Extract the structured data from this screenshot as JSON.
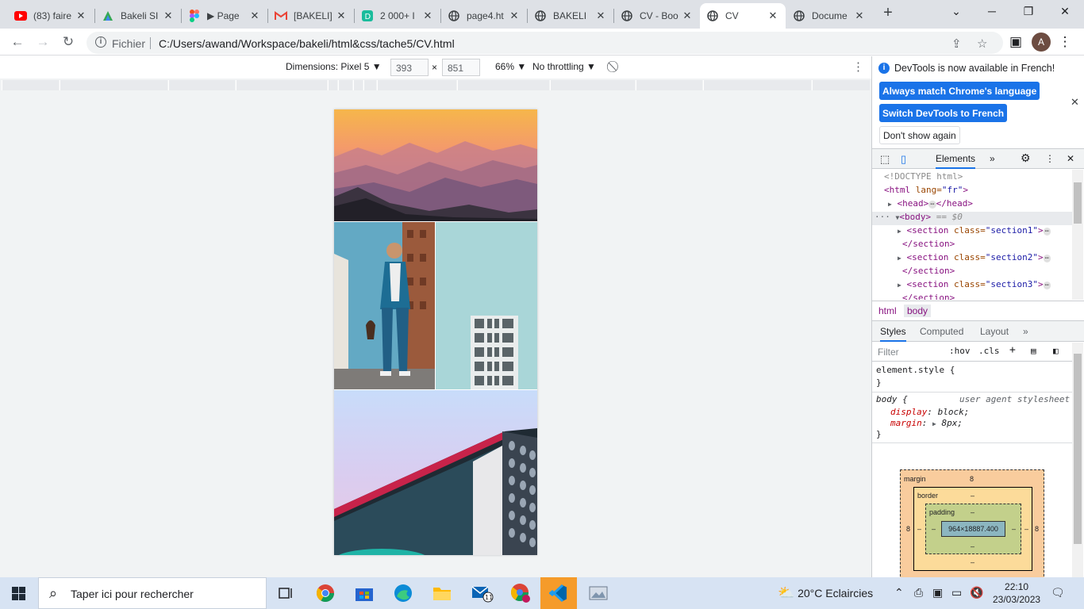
{
  "browser": {
    "tabs": [
      {
        "title": "(83) faire",
        "icon": "youtube-icon",
        "active": false
      },
      {
        "title": "Bakeli SI",
        "icon": "bakeli-icon",
        "active": false
      },
      {
        "title": "▶ Page",
        "icon": "figma-icon",
        "active": false
      },
      {
        "title": "[BAKELI]",
        "icon": "gmail-icon",
        "active": false
      },
      {
        "title": "2 000+ I",
        "icon": "d-icon",
        "active": false
      },
      {
        "title": "page4.ht",
        "icon": "globe-icon",
        "active": false
      },
      {
        "title": "BAKELI",
        "icon": "globe-icon",
        "active": false
      },
      {
        "title": "CV - Boo",
        "icon": "globe-icon",
        "active": false
      },
      {
        "title": "CV",
        "icon": "globe-icon",
        "active": true
      },
      {
        "title": "Docume",
        "icon": "globe-icon",
        "active": false
      }
    ],
    "new_tab": "+",
    "address": {
      "scheme_label": "Fichier",
      "url": "C:/Users/awand/Workspace/bakeli/html&css/tache5/CV.html"
    },
    "profile_initial": "A"
  },
  "device_toolbar": {
    "dimensions_label": "Dimensions: Pixel 5 ▼",
    "width": "393",
    "times": "×",
    "height": "851",
    "zoom": "66% ▼",
    "throttling": "No throttling ▼"
  },
  "devtools": {
    "notice": "DevTools is now available in French!",
    "btn_match": "Always match Chrome's language",
    "btn_switch": "Switch DevTools to French",
    "btn_dont_show": "Don't show again",
    "panel_tab": "Elements",
    "dom": {
      "doctype": "<!DOCTYPE html>",
      "html_open_tag": "<html",
      "html_attr": " lang=",
      "html_attr_val": "\"fr\"",
      "html_close": ">",
      "head_open": "<head>",
      "head_close": "</head>",
      "body_open": "<body>",
      "body_eq": " == $0",
      "section_open": "<section",
      "section_attr": " class=",
      "section1_val": "\"section1\"",
      "section2_val": "\"section2\"",
      "section3_val": "\"section3\"",
      "gt": ">",
      "section_close": "</section>",
      "ellipsis": "⋯"
    },
    "breadcrumbs": [
      "html",
      "body"
    ],
    "sub_tabs": [
      "Styles",
      "Computed",
      "Layout"
    ],
    "filter_placeholder": "Filter",
    "filter_hov": ":hov",
    "filter_cls": ".cls",
    "styles": {
      "element_style": "element.style {",
      "close_brace": "}",
      "body_selector": "body {",
      "ua_source": "user agent stylesheet",
      "p1_name": "display",
      "p1_val": "block;",
      "p2_name": "margin",
      "p2_val": "8px;"
    },
    "box_model": {
      "margin_label": "margin",
      "margin_top": "8",
      "margin_left": "8",
      "margin_right": "8",
      "border_label": "border",
      "border_top": "–",
      "border_bottom": "–",
      "border_left": "–",
      "border_right": "–",
      "padding_label": "padding",
      "padding_top": "–",
      "padding_bottom": "–",
      "padding_left": "–",
      "padding_right": "–",
      "content": "964×18887.400"
    }
  },
  "taskbar": {
    "search_placeholder": "Taper ici pour rechercher",
    "weather": "20°C  Eclaircies",
    "time": "22:10",
    "date": "23/03/2023",
    "mail_badge": "11"
  },
  "colors": {
    "accent": "#1a73e8",
    "taskbar_bg": "#d7e3f3",
    "tab_strip": "#dee1e6"
  }
}
